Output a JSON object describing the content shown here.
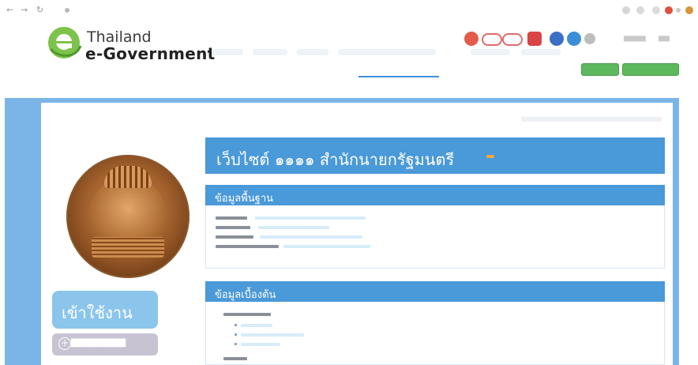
{
  "header": {
    "logo_line1": "Thailand",
    "logo_line2": "e-Government",
    "logo_letter": "e"
  },
  "page": {
    "title": "เว็บไซต์ ๑๑๑๑ สำนักนายกรัฐมนตรี",
    "section_basic": "ข้อมูลพื้นฐาน",
    "section_intro": "ข้อมูลเบื้องต้น"
  },
  "sidebar": {
    "login_label": "เข้าใช้งาน"
  },
  "colors": {
    "primary_blue": "#4a99d8",
    "page_background": "#7bb5e8",
    "login_button": "#8cc5ec",
    "green_button": "#5cb85c"
  },
  "icons": [
    "back-icon",
    "forward-icon",
    "reload-icon",
    "facebook-icon",
    "twitter-icon",
    "plus-icon"
  ]
}
